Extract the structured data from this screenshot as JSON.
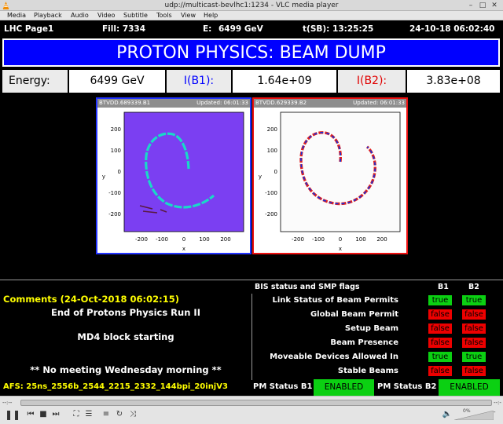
{
  "window": {
    "title": "udp://multicast-bevlhc1:1234 - VLC media player"
  },
  "menu": [
    "Media",
    "Playback",
    "Audio",
    "Video",
    "Subtitle",
    "Tools",
    "View",
    "Help"
  ],
  "header": {
    "page": "LHC Page1",
    "fill": "Fill: 7334",
    "energy_label": "E:",
    "energy_value": "6499 GeV",
    "tsb": "t(SB): 13:25:25",
    "datetime": "24-10-18 06:02:40"
  },
  "banner": "PROTON PHYSICS: BEAM DUMP",
  "energy_row": {
    "energy_label": "Energy:",
    "energy_value": "6499 GeV",
    "ib1_label": "I(B1):",
    "ib1_value": "1.64e+09",
    "ib2_label": "I(B2):",
    "ib2_value": "3.83e+08"
  },
  "plots": [
    {
      "name": "BTVDD.689339.B1",
      "updated": "Updated: 06:01:33",
      "xlabel": "x",
      "ylabel": "y",
      "xticks": [
        "-200",
        "-100",
        "0",
        "100",
        "200"
      ],
      "yticks": [
        "200",
        "100",
        "0",
        "-100",
        "-200"
      ]
    },
    {
      "name": "BTVDD.629339.B2",
      "updated": "Updated: 06:01:33",
      "xlabel": "x",
      "ylabel": "y",
      "xticks": [
        "-200",
        "-100",
        "0",
        "100",
        "200"
      ],
      "yticks": [
        "200",
        "100",
        "0",
        "-100",
        "-200"
      ]
    }
  ],
  "bis": {
    "title": "BIS status and SMP flags",
    "b1": "B1",
    "b2": "B2",
    "rows": [
      {
        "label": "Link Status of Beam Permits",
        "b1": "true",
        "b2": "true"
      },
      {
        "label": "Global Beam Permit",
        "b1": "false",
        "b2": "false"
      },
      {
        "label": "Setup Beam",
        "b1": "false",
        "b2": "false"
      },
      {
        "label": "Beam Presence",
        "b1": "false",
        "b2": "false"
      },
      {
        "label": "Moveable Devices Allowed In",
        "b1": "true",
        "b2": "true"
      },
      {
        "label": "Stable Beams",
        "b1": "false",
        "b2": "false"
      }
    ]
  },
  "comments": {
    "header": "Comments (24-Oct-2018 06:02:15)",
    "lines": [
      "End of Protons Physics Run II",
      "MD4 block starting",
      "** No meeting Wednesday morning **"
    ]
  },
  "footer": {
    "afs": "AFS: 25ns_2556b_2544_2215_2332_144bpi_20injV3",
    "pm_b1_label": "PM Status B1",
    "pm_b1_value": "ENABLED",
    "pm_b2_label": "PM Status B2",
    "pm_b2_value": "ENABLED"
  },
  "player": {
    "time_left": "--:--",
    "time_right": "--:--",
    "volume": "0%",
    "progress": 0
  },
  "colors": {
    "banner": "#0000ff",
    "flag_true": "#0bd012",
    "flag_false": "#ee0000",
    "plot_b1_border": "#2233ff",
    "plot_b2_border": "#ee1111",
    "plot_b1_bg": "#7b3ff2"
  },
  "icons": [
    "vlc-cone-icon",
    "pause-icon",
    "previous-icon",
    "stop-icon",
    "next-icon",
    "fullscreen-icon",
    "extended-settings-icon",
    "playlist-icon",
    "loop-icon",
    "shuffle-icon",
    "volume-icon"
  ]
}
